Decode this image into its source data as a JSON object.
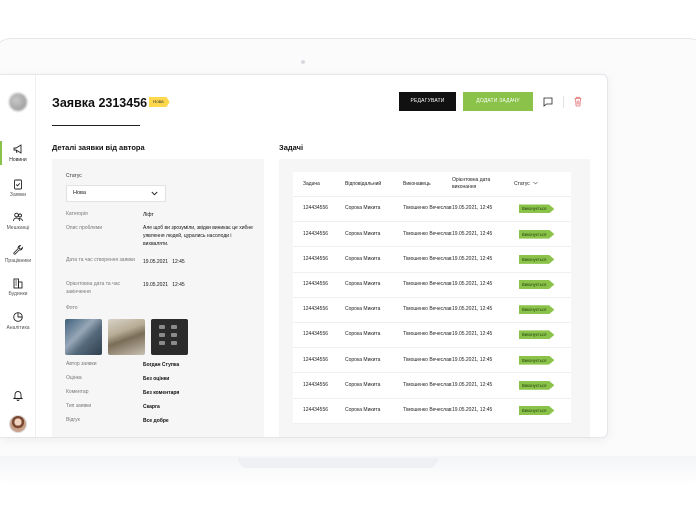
{
  "sidebar": {
    "items": [
      {
        "label": "Новини",
        "icon": "megaphone-icon"
      },
      {
        "label": "Заявки",
        "icon": "clipboard-check-icon"
      },
      {
        "label": "Мешканці",
        "icon": "people-icon"
      },
      {
        "label": "Працівники",
        "icon": "wrench-icon"
      },
      {
        "label": "Будинки",
        "icon": "buildings-icon"
      },
      {
        "label": "Аналітика",
        "icon": "analytics-icon"
      }
    ],
    "active_index": 0
  },
  "header": {
    "title": "Заявка 2313456",
    "badge": "Нова",
    "edit_button": "Редагувати",
    "add_task_button": "Додати задачу"
  },
  "details": {
    "title": "Деталі заявки від автора",
    "status_label": "Статус",
    "status_value": "Нова",
    "fields": [
      {
        "label": "Категорія",
        "value": "Ліфт"
      },
      {
        "label": "Опис проблеми",
        "value": "Але щоб ви зрозуміли, звідки виникає це хибне уявлення людей, цурались насолоди і вихваляти."
      },
      {
        "label": "Дата та час створення заявки",
        "value": "19.05.2021   12:45"
      },
      {
        "label": "Орієнтовна дата та час закінчення",
        "value": "19.05.2021   12:45"
      },
      {
        "label": "Фото",
        "value": ""
      },
      {
        "label": "Автор заявки",
        "value": "Богдан Ступка"
      },
      {
        "label": "Оцінка",
        "value": "Без оцінки"
      },
      {
        "label": "Коментар",
        "value": "Без коментаря"
      },
      {
        "label": "Тип заявки",
        "value": "Скарга"
      },
      {
        "label": "Відгук",
        "value": "Все добре"
      }
    ]
  },
  "tasks": {
    "title": "Задачі",
    "columns": [
      "Задача",
      "Відповідальний",
      "Виконавець",
      "Орієнтовна дата виконання",
      "Статус"
    ],
    "rows": [
      {
        "task": "124434556",
        "responsible": "Сорока Микита",
        "executor": "Тімошенко Вечеслав",
        "date": "19.05.2021, 12:45",
        "status": "Виконується"
      },
      {
        "task": "124434556",
        "responsible": "Сорока Микита",
        "executor": "Тімошенко Вечеслав",
        "date": "19.05.2021, 12:45",
        "status": "Виконується"
      },
      {
        "task": "124434556",
        "responsible": "Сорока Микита",
        "executor": "Тімошенко Вечеслав",
        "date": "19.05.2021, 12:45",
        "status": "Виконується"
      },
      {
        "task": "124434556",
        "responsible": "Сорока Микита",
        "executor": "Тімошенко Вечеслав",
        "date": "19.05.2021, 12:45",
        "status": "Виконується"
      },
      {
        "task": "124434556",
        "responsible": "Сорока Микита",
        "executor": "Тімошенко Вечеслав",
        "date": "19.05.2021, 12:45",
        "status": "Виконується"
      },
      {
        "task": "124434556",
        "responsible": "Сорока Микита",
        "executor": "Тімошенко Вечеслав",
        "date": "19.05.2021, 12:45",
        "status": "Виконується"
      },
      {
        "task": "124434556",
        "responsible": "Сорока Микита",
        "executor": "Тімошенко Вечеслав",
        "date": "19.05.2021, 12:45",
        "status": "Виконується"
      },
      {
        "task": "124434556",
        "responsible": "Сорока Микита",
        "executor": "Тімошенко Вечеслав",
        "date": "19.05.2021, 12:45",
        "status": "Виконується"
      },
      {
        "task": "124434556",
        "responsible": "Сорока Микита",
        "executor": "Тімошенко Вечеслав",
        "date": "19.05.2021, 12:45",
        "status": "Виконується"
      }
    ]
  },
  "colors": {
    "accent": "#8bc34a",
    "badge_new": "#ffd84d",
    "primary_button": "#111111",
    "delete": "#e57373"
  }
}
